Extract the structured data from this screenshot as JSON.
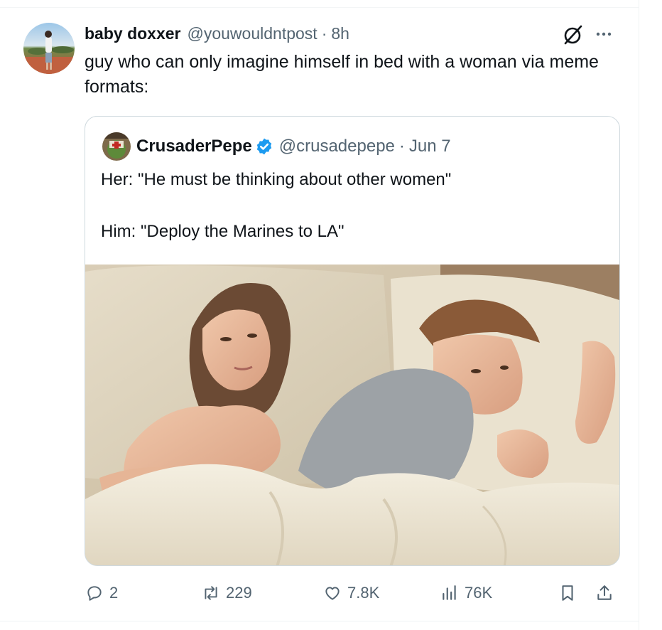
{
  "tweet": {
    "display_name": "baby doxxer",
    "handle": "@youwouldntpost",
    "separator": "·",
    "time": "8h",
    "text": "guy who can only imagine himself in bed with a woman via meme formats:"
  },
  "quoted_tweet": {
    "display_name": "CrusaderPepe",
    "handle": "@crusadepepe",
    "separator": "·",
    "date": "Jun 7",
    "line1": "Her: \"He must be thinking about other women\"",
    "line2": "Him: \"Deploy the Marines to LA\"",
    "media": "photo"
  },
  "actions": {
    "replies": "2",
    "reposts": "229",
    "likes": "7.8K",
    "views": "76K"
  },
  "icons": {
    "grok": "grok-icon",
    "more": "more-icon",
    "verified": "verified-badge-icon",
    "reply": "reply-icon",
    "repost": "repost-icon",
    "like": "heart-icon",
    "views": "views-chart-icon",
    "bookmark": "bookmark-icon",
    "share": "share-icon"
  },
  "colors": {
    "text": "#0f1419",
    "secondary": "#536471",
    "verified": "#1d9bf0",
    "border": "#cfd9de"
  }
}
